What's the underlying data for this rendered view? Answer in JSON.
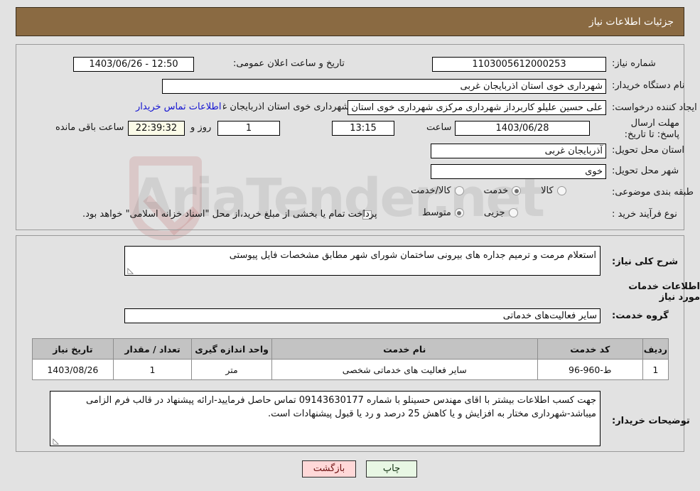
{
  "header": {
    "title": "جزئیات اطلاعات نیاز"
  },
  "need_info": {
    "need_number_label": "شماره نیاز:",
    "need_number_value": "1103005612000253",
    "announce_datetime_label": "تاریخ و ساعت اعلان عمومی:",
    "announce_datetime_value": "12:50 - 1403/06/26",
    "buyer_org_label": "نام دستگاه خریدار:",
    "buyer_org_value": "شهرداری خوی استان اذربایجان غربی",
    "requester_label": "ایجاد کننده درخواست:",
    "requester_value": "علی حسین علیلو کاربرداز شهرداری مرکزی شهرداری خوی استان اذربایجان غرب",
    "contact_link": "اطلاعات تماس خریدار",
    "deadline_label": "مهلت ارسال پاسخ: تا تاریخ:",
    "deadline_date": "1403/06/28",
    "hour_label": "ساعت",
    "deadline_time": "13:15",
    "days_value": "1",
    "days_label": "روز و",
    "countdown_value": "22:39:32",
    "countdown_label": "ساعت باقی مانده",
    "province_label": "استان محل تحویل:",
    "province_value": "آذربایجان غربی",
    "city_label": "شهر محل تحویل:",
    "city_value": "خوی",
    "category_label": "طبقه بندی موضوعی:",
    "category_options": [
      {
        "label": "کالا",
        "selected": false
      },
      {
        "label": "خدمت",
        "selected": true
      },
      {
        "label": "کالا/خدمت",
        "selected": false
      }
    ],
    "process_label": "نوع فرآیند خرید :",
    "process_options": [
      {
        "label": "جزیی",
        "selected": false
      },
      {
        "label": "متوسط",
        "selected": true
      }
    ],
    "treasury_checkbox_checked": false,
    "treasury_text": "پرداخت تمام یا بخشی از مبلغ خرید،از محل \"اسناد خزانه اسلامی\" خواهد بود."
  },
  "details": {
    "summary_label": "شرح کلی نیاز:",
    "summary_value": "استعلام مرمت و ترمیم جداره های بیرونی ساختمان شورای شهر مطابق مشخصات فایل پیوستی",
    "services_heading": "اطلاعات خدمات مورد نیاز",
    "service_group_label": "گروه خدمت:",
    "service_group_value": "سایر فعالیت‌های خدماتی"
  },
  "table": {
    "headers": [
      "ردیف",
      "کد خدمت",
      "نام خدمت",
      "واحد اندازه گیری",
      "تعداد / مقدار",
      "تاریخ نیاز"
    ],
    "rows": [
      {
        "radif": "1",
        "code": "ط-960-96",
        "name": "سایر فعالیت های خدماتی شخصی",
        "unit": "متر",
        "qty": "1",
        "date": "1403/08/26"
      }
    ]
  },
  "buyer_notes": {
    "label": "توضیحات خریدار:",
    "value": "جهت کسب اطلاعات بیشتر با اقای مهندس حسینلو با شماره 09143630177 تماس حاصل فرمایید-ارائه پیشنهاد در قالب فرم الزامی میباشد-شهرداری مختار به افزایش و یا کاهش 25 درصد و رد یا قبول پیشنهادات است."
  },
  "footer": {
    "print_label": "چاپ",
    "back_label": "بازگشت"
  },
  "watermark": {
    "text": "AriaTender.net"
  },
  "colors": {
    "header_bar": "#8a6a42",
    "page_background": "#e2e2e2",
    "link": "#1414d2",
    "table_header": "#c3c3c3",
    "print_button": "#e8f7e4",
    "back_button": "#ffd8d8",
    "countdown_field": "#fbfbe8"
  }
}
